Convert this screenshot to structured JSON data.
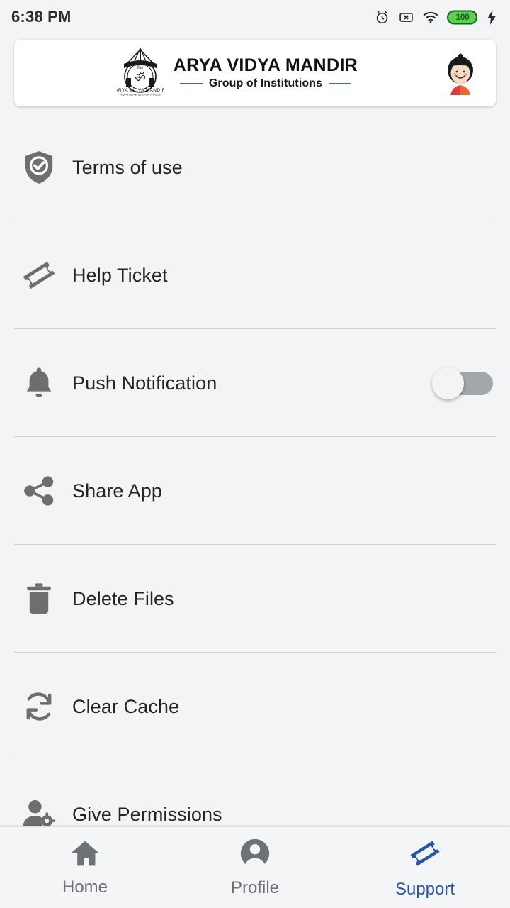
{
  "status_bar": {
    "time": "6:38 PM",
    "icons": [
      "alarm-icon",
      "no-sim-icon",
      "wifi-icon",
      "battery-icon",
      "charging-bolt-icon"
    ],
    "battery_level": "100"
  },
  "header": {
    "logo": "school-crest-logo",
    "title": "ARYA VIDYA MANDIR",
    "subtitle": "Group of Institutions",
    "avatar": "user-avatar",
    "rule_color": "#4a6b7c"
  },
  "menu": {
    "items": [
      {
        "label": "Terms of use",
        "icon": "shield-check-icon",
        "type": "link"
      },
      {
        "label": "Help Ticket",
        "icon": "ticket-icon",
        "type": "link"
      },
      {
        "label": "Push Notification",
        "icon": "bell-icon",
        "type": "toggle",
        "toggle_on": false
      },
      {
        "label": "Share App",
        "icon": "share-icon",
        "type": "link"
      },
      {
        "label": "Delete Files",
        "icon": "trash-icon",
        "type": "link"
      },
      {
        "label": "Clear Cache",
        "icon": "refresh-icon",
        "type": "link"
      },
      {
        "label": "Give Permissions",
        "icon": "person-gear-icon",
        "type": "link"
      }
    ]
  },
  "bottom_nav": {
    "active": "Support",
    "active_color": "#2558ad",
    "inactive_color": "#6e7276",
    "items": [
      {
        "label": "Home",
        "icon": "home-icon"
      },
      {
        "label": "Profile",
        "icon": "person-circle-icon"
      },
      {
        "label": "Support",
        "icon": "ticket-icon"
      }
    ]
  }
}
